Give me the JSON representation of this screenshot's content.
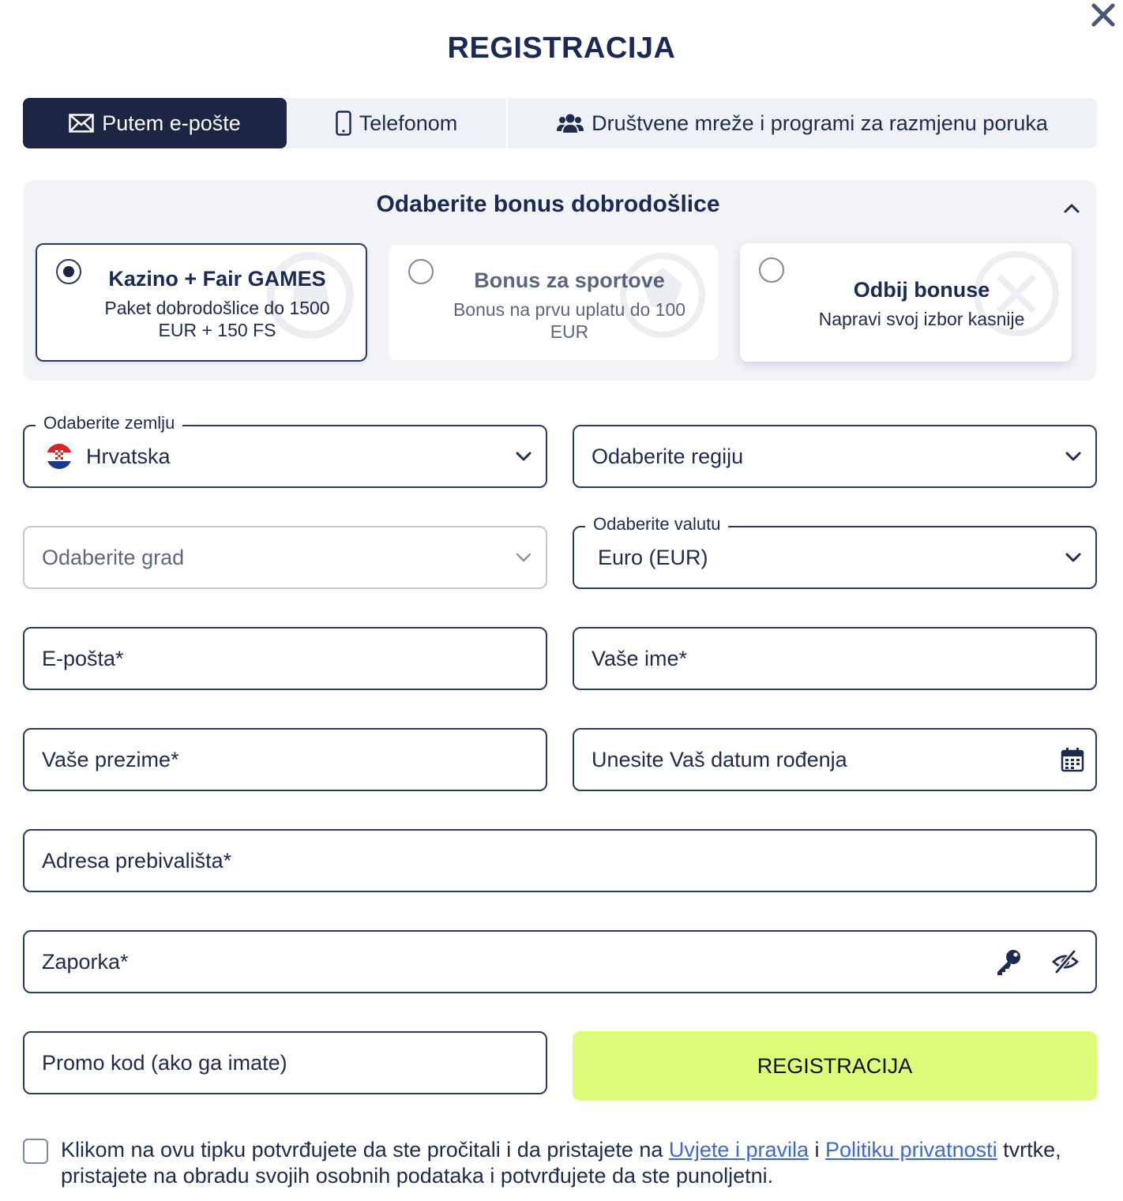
{
  "header": {
    "title": "REGISTRACIJA",
    "close_icon": "close-icon"
  },
  "tabs": [
    {
      "label": "Putem e-pošte",
      "icon": "envelope-icon",
      "active": true
    },
    {
      "label": "Telefonom",
      "icon": "phone-icon",
      "active": false
    },
    {
      "label": "Društvene mreže i programi za razmjenu poruka",
      "icon": "users-icon",
      "active": false
    }
  ],
  "bonus": {
    "title": "Odaberite bonus dobrodošlice",
    "options": [
      {
        "title": "Kazino + Fair GAMES",
        "line1": "Paket dobrodošlice do 1500",
        "line2": "EUR + 150 FS",
        "selected": true
      },
      {
        "title": "Bonus za sportove",
        "line1": "Bonus na prvu uplatu do 100",
        "line2": "EUR",
        "selected": false
      },
      {
        "title": "Odbij bonuse",
        "line1": "Napravi svoj izbor kasnije",
        "selected": false
      }
    ]
  },
  "form": {
    "country": {
      "legend": "Odaberite zemlju",
      "value": "Hrvatska",
      "flag": "croatia-flag"
    },
    "region": {
      "placeholder": "Odaberite regiju"
    },
    "city": {
      "placeholder": "Odaberite grad"
    },
    "currency": {
      "legend": "Odaberite valutu",
      "value": "Euro (EUR)"
    },
    "email": {
      "placeholder": "E-pošta*"
    },
    "first_name": {
      "placeholder": "Vaše ime*"
    },
    "last_name": {
      "placeholder": "Vaše prezime*"
    },
    "birth_date": {
      "placeholder": "Unesite Vaš datum rođenja",
      "icon": "calendar-icon"
    },
    "address": {
      "placeholder": "Adresa prebivališta*"
    },
    "password": {
      "placeholder": "Zaporka*",
      "icons": [
        "key-icon",
        "eye-slash-icon"
      ]
    },
    "promo": {
      "placeholder": "Promo kod (ako ga imate)"
    },
    "submit_label": "REGISTRACIJA"
  },
  "terms": {
    "text_before": "Klikom na ovu tipku potvrđujete da ste pročitali i da pristajete na ",
    "link_terms": "Uvjete i pravila",
    "between": " i ",
    "link_privacy": "Politiku privatnosti",
    "text_after": " tvrtke, pristajete na obradu svojih osobnih podataka i potvrđujete da ste punoljetni."
  },
  "colors": {
    "primary_dark": "#1d2545",
    "accent_lime": "#ddfc78",
    "link_blue": "#3b68d8",
    "panel_bg": "#f2f4f8"
  }
}
